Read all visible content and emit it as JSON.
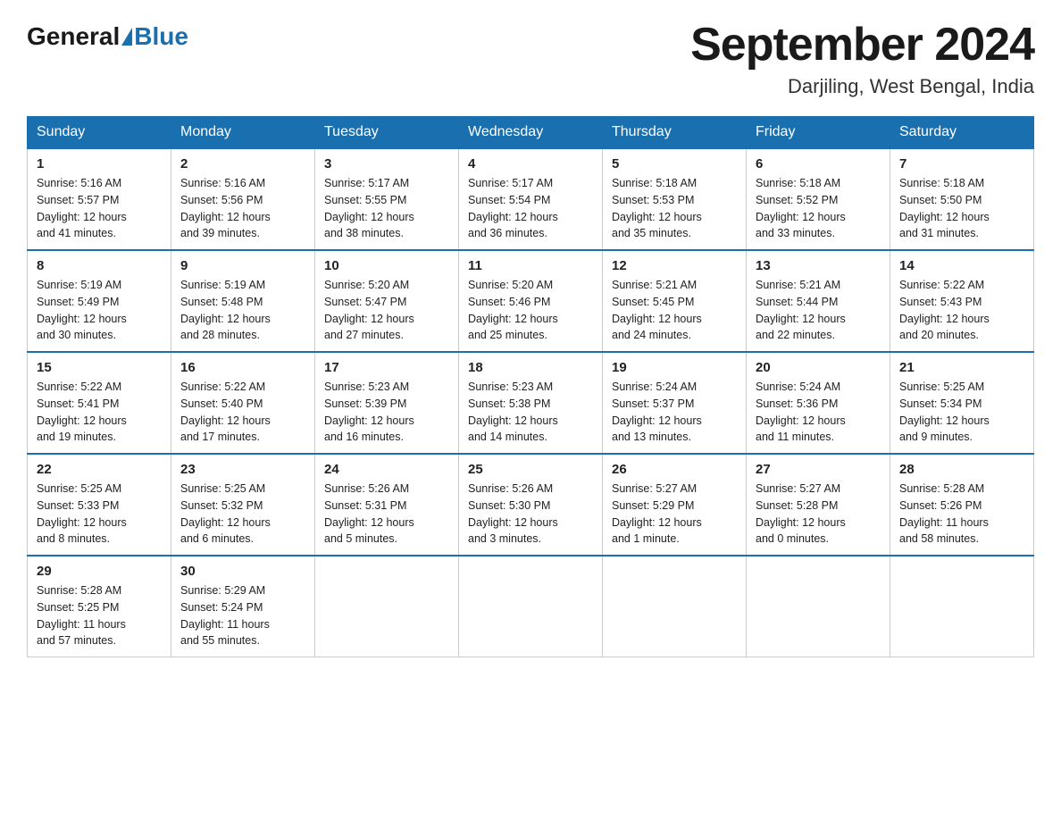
{
  "header": {
    "logo_general": "General",
    "logo_blue": "Blue",
    "month_title": "September 2024",
    "location": "Darjiling, West Bengal, India"
  },
  "days_of_week": [
    "Sunday",
    "Monday",
    "Tuesday",
    "Wednesday",
    "Thursday",
    "Friday",
    "Saturday"
  ],
  "weeks": [
    [
      {
        "day": "1",
        "sunrise": "5:16 AM",
        "sunset": "5:57 PM",
        "daylight": "12 hours and 41 minutes."
      },
      {
        "day": "2",
        "sunrise": "5:16 AM",
        "sunset": "5:56 PM",
        "daylight": "12 hours and 39 minutes."
      },
      {
        "day": "3",
        "sunrise": "5:17 AM",
        "sunset": "5:55 PM",
        "daylight": "12 hours and 38 minutes."
      },
      {
        "day": "4",
        "sunrise": "5:17 AM",
        "sunset": "5:54 PM",
        "daylight": "12 hours and 36 minutes."
      },
      {
        "day": "5",
        "sunrise": "5:18 AM",
        "sunset": "5:53 PM",
        "daylight": "12 hours and 35 minutes."
      },
      {
        "day": "6",
        "sunrise": "5:18 AM",
        "sunset": "5:52 PM",
        "daylight": "12 hours and 33 minutes."
      },
      {
        "day": "7",
        "sunrise": "5:18 AM",
        "sunset": "5:50 PM",
        "daylight": "12 hours and 31 minutes."
      }
    ],
    [
      {
        "day": "8",
        "sunrise": "5:19 AM",
        "sunset": "5:49 PM",
        "daylight": "12 hours and 30 minutes."
      },
      {
        "day": "9",
        "sunrise": "5:19 AM",
        "sunset": "5:48 PM",
        "daylight": "12 hours and 28 minutes."
      },
      {
        "day": "10",
        "sunrise": "5:20 AM",
        "sunset": "5:47 PM",
        "daylight": "12 hours and 27 minutes."
      },
      {
        "day": "11",
        "sunrise": "5:20 AM",
        "sunset": "5:46 PM",
        "daylight": "12 hours and 25 minutes."
      },
      {
        "day": "12",
        "sunrise": "5:21 AM",
        "sunset": "5:45 PM",
        "daylight": "12 hours and 24 minutes."
      },
      {
        "day": "13",
        "sunrise": "5:21 AM",
        "sunset": "5:44 PM",
        "daylight": "12 hours and 22 minutes."
      },
      {
        "day": "14",
        "sunrise": "5:22 AM",
        "sunset": "5:43 PM",
        "daylight": "12 hours and 20 minutes."
      }
    ],
    [
      {
        "day": "15",
        "sunrise": "5:22 AM",
        "sunset": "5:41 PM",
        "daylight": "12 hours and 19 minutes."
      },
      {
        "day": "16",
        "sunrise": "5:22 AM",
        "sunset": "5:40 PM",
        "daylight": "12 hours and 17 minutes."
      },
      {
        "day": "17",
        "sunrise": "5:23 AM",
        "sunset": "5:39 PM",
        "daylight": "12 hours and 16 minutes."
      },
      {
        "day": "18",
        "sunrise": "5:23 AM",
        "sunset": "5:38 PM",
        "daylight": "12 hours and 14 minutes."
      },
      {
        "day": "19",
        "sunrise": "5:24 AM",
        "sunset": "5:37 PM",
        "daylight": "12 hours and 13 minutes."
      },
      {
        "day": "20",
        "sunrise": "5:24 AM",
        "sunset": "5:36 PM",
        "daylight": "12 hours and 11 minutes."
      },
      {
        "day": "21",
        "sunrise": "5:25 AM",
        "sunset": "5:34 PM",
        "daylight": "12 hours and 9 minutes."
      }
    ],
    [
      {
        "day": "22",
        "sunrise": "5:25 AM",
        "sunset": "5:33 PM",
        "daylight": "12 hours and 8 minutes."
      },
      {
        "day": "23",
        "sunrise": "5:25 AM",
        "sunset": "5:32 PM",
        "daylight": "12 hours and 6 minutes."
      },
      {
        "day": "24",
        "sunrise": "5:26 AM",
        "sunset": "5:31 PM",
        "daylight": "12 hours and 5 minutes."
      },
      {
        "day": "25",
        "sunrise": "5:26 AM",
        "sunset": "5:30 PM",
        "daylight": "12 hours and 3 minutes."
      },
      {
        "day": "26",
        "sunrise": "5:27 AM",
        "sunset": "5:29 PM",
        "daylight": "12 hours and 1 minute."
      },
      {
        "day": "27",
        "sunrise": "5:27 AM",
        "sunset": "5:28 PM",
        "daylight": "12 hours and 0 minutes."
      },
      {
        "day": "28",
        "sunrise": "5:28 AM",
        "sunset": "5:26 PM",
        "daylight": "11 hours and 58 minutes."
      }
    ],
    [
      {
        "day": "29",
        "sunrise": "5:28 AM",
        "sunset": "5:25 PM",
        "daylight": "11 hours and 57 minutes."
      },
      {
        "day": "30",
        "sunrise": "5:29 AM",
        "sunset": "5:24 PM",
        "daylight": "11 hours and 55 minutes."
      },
      null,
      null,
      null,
      null,
      null
    ]
  ],
  "labels": {
    "sunrise": "Sunrise:",
    "sunset": "Sunset:",
    "daylight": "Daylight:"
  }
}
